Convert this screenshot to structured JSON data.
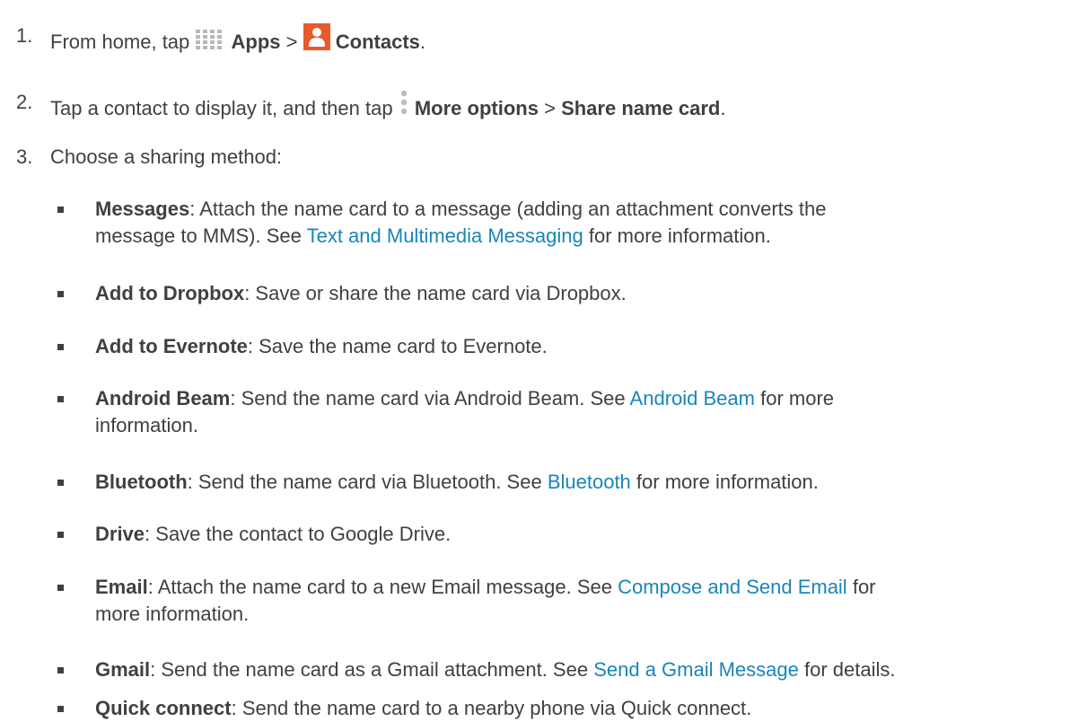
{
  "steps": [
    {
      "num": "1.",
      "t1": "From home, tap",
      "apps_label": "Apps",
      "sep": ">",
      "contacts_label": "Contacts",
      "end": ".",
      "apps_icon": "apps-grid-icon",
      "contacts_icon": "contacts-icon",
      "contacts_color": "#e8592b"
    },
    {
      "num": "2.",
      "t1": "Tap a contact to display it, and then tap",
      "more_label": "More options",
      "sep": ">",
      "share_label": "Share name card",
      "end": ".",
      "more_icon": "more-options-icon"
    },
    {
      "num": "3.",
      "t1": "Choose a sharing method:"
    }
  ],
  "methods": [
    {
      "name": "Messages",
      "desc1": ": Attach the name card to a message (adding an attachment converts the",
      "desc2": "message to MMS). See",
      "link": "Text and Multimedia Messaging",
      "after": "for more information."
    },
    {
      "name": "Add to Dropbox",
      "desc": ": Save or share the name card via Dropbox."
    },
    {
      "name": "Add to Evernote",
      "desc": ": Save the name card to Evernote."
    },
    {
      "name": "Android Beam",
      "desc": ": Send the name card via Android Beam. See",
      "link": "Android Beam",
      "after1": "for more",
      "after2": "information."
    },
    {
      "name": "Bluetooth",
      "desc": ": Send the name card via Bluetooth. See",
      "link": "Bluetooth",
      "after": "for more information."
    },
    {
      "name": "Drive",
      "desc": ": Save the contact to Google Drive."
    },
    {
      "name": "Email",
      "desc": ": Attach the name card to a new Email message. See",
      "link": "Compose and Send Email",
      "after1": "for",
      "after2": "more information."
    },
    {
      "name": "Gmail",
      "desc": ": Send the name card as a Gmail attachment. See",
      "link": "Send a Gmail Message",
      "after": "for details."
    },
    {
      "name": "Quick connect",
      "desc": ": Send the name card to a nearby phone via Quick connect."
    }
  ],
  "colors": {
    "text": "#404040",
    "link": "#1a85b8"
  }
}
